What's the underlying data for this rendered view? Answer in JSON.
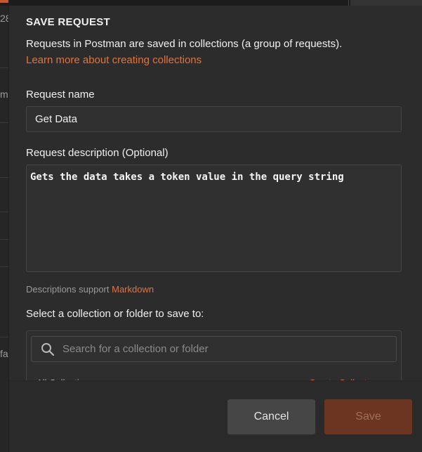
{
  "background": {
    "left_fragments": [
      "28",
      "m",
      "fa"
    ]
  },
  "modal": {
    "title": "SAVE REQUEST",
    "intro": "Requests in Postman are saved in collections (a group of requests).",
    "learn_more": "Learn more about creating collections",
    "request_name_label": "Request name",
    "request_name_value": "Get Data",
    "description_label": "Request description (Optional)",
    "description_value": "Gets the data takes a token value in the query string",
    "hint_prefix": "Descriptions support",
    "hint_link": "Markdown",
    "collection_label": "Select a collection or folder to save to:",
    "search_placeholder": "Search for a collection or folder",
    "partial_row_left": "All Collecti",
    "partial_row_right": "Create Collect"
  },
  "footer": {
    "cancel_label": "Cancel",
    "save_label": "Save"
  },
  "icons": {
    "search": "search-icon"
  },
  "colors": {
    "accent": "#e8713a",
    "save_disabled_bg": "#6b3522",
    "modal_bg": "#2c2c2c"
  }
}
